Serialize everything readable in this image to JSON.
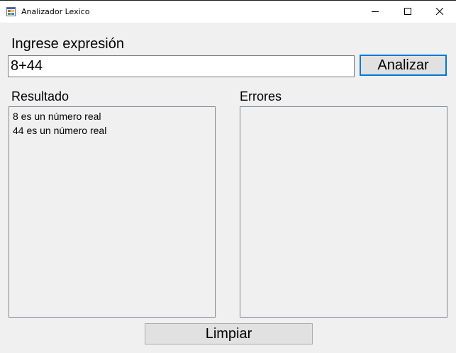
{
  "window": {
    "title": "Analizador Lexico"
  },
  "form": {
    "expression_label": "Ingrese expresión",
    "expression_value": "8+44",
    "analyze_button": "Analizar",
    "result_label": "Resultado",
    "errors_label": "Errores",
    "clear_button": "Limpiar",
    "results": [
      "8 es un número real",
      "44 es un número real"
    ],
    "errors": []
  },
  "icons": {
    "app": "app-form-icon",
    "minimize": "minimize-icon",
    "maximize": "maximize-icon",
    "close": "close-icon"
  },
  "colors": {
    "window_bg": "#f0f0f0",
    "accent_focus": "#0078d7",
    "button_bg": "#e1e1e1"
  }
}
